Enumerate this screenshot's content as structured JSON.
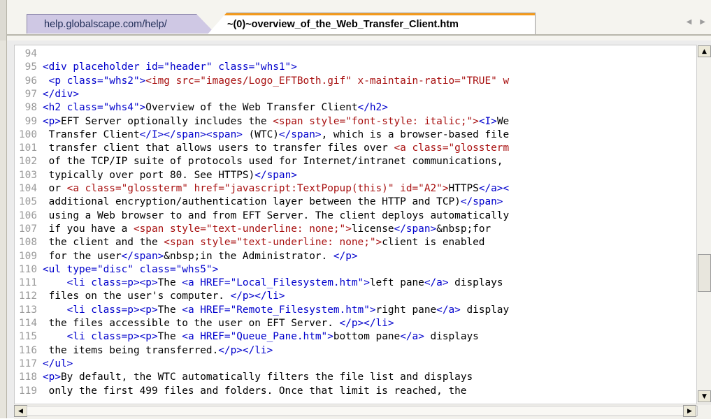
{
  "tabs": [
    {
      "label": "help.globalscape.com/help/"
    },
    {
      "label": "~(0)~overview_of_the_Web_Transfer_Client.htm"
    }
  ],
  "nav": {
    "left": "◀",
    "right": "▶"
  },
  "scroll": {
    "up": "▲",
    "down": "▼",
    "left": "◀",
    "right": "▶"
  },
  "code_lines": [
    {
      "n": "94",
      "segs": []
    },
    {
      "n": "95",
      "segs": [
        {
          "t": "t",
          "v": "<div placeholder id=\"header\" class=\"whs1\">"
        }
      ]
    },
    {
      "n": "96",
      "segs": [
        {
          "t": "t",
          "v": " <p class=\"whs2\">"
        },
        {
          "t": "s",
          "v": "<img src=\"images/Logo_EFTBoth.gif\" x-maintain-ratio=\"TRUE\" w"
        }
      ]
    },
    {
      "n": "97",
      "segs": [
        {
          "t": "t",
          "v": "</div>"
        }
      ]
    },
    {
      "n": "98",
      "segs": [
        {
          "t": "t",
          "v": "<h2 class=\"whs4\">"
        },
        {
          "t": "x",
          "v": "Overview of the Web Transfer Client"
        },
        {
          "t": "t",
          "v": "</h2>"
        }
      ]
    },
    {
      "n": "99",
      "segs": [
        {
          "t": "t",
          "v": "<p>"
        },
        {
          "t": "x",
          "v": "EFT Server optionally includes the "
        },
        {
          "t": "s",
          "v": "<span style=\"font-style: italic;\">"
        },
        {
          "t": "t",
          "v": "<I>"
        },
        {
          "t": "x",
          "v": "We"
        }
      ]
    },
    {
      "n": "100",
      "segs": [
        {
          "t": "x",
          "v": " Transfer Client"
        },
        {
          "t": "t",
          "v": "</I></span><span>"
        },
        {
          "t": "x",
          "v": " (WTC)"
        },
        {
          "t": "t",
          "v": "</span>"
        },
        {
          "t": "x",
          "v": ", which is a browser-based file"
        }
      ]
    },
    {
      "n": "101",
      "segs": [
        {
          "t": "x",
          "v": " transfer client that allows users to transfer files over "
        },
        {
          "t": "s",
          "v": "<a class=\"glossterm"
        }
      ]
    },
    {
      "n": "102",
      "segs": [
        {
          "t": "x",
          "v": " of the TCP/IP suite of protocols used for Internet/intranet communications,"
        }
      ]
    },
    {
      "n": "103",
      "segs": [
        {
          "t": "x",
          "v": " typically over port 80. See HTTPS)"
        },
        {
          "t": "t",
          "v": "</span>"
        }
      ]
    },
    {
      "n": "104",
      "segs": [
        {
          "t": "x",
          "v": " or "
        },
        {
          "t": "s",
          "v": "<a class=\"glossterm\" href=\"javascript:TextPopup(this)\" id=\"A2\">"
        },
        {
          "t": "x",
          "v": "HTTPS"
        },
        {
          "t": "t",
          "v": "</a><"
        }
      ]
    },
    {
      "n": "105",
      "segs": [
        {
          "t": "x",
          "v": " additional encryption/authentication layer between the HTTP and TCP)"
        },
        {
          "t": "t",
          "v": "</span>"
        }
      ]
    },
    {
      "n": "106",
      "segs": [
        {
          "t": "x",
          "v": " using a Web browser to and from EFT Server. The client deploys automatically"
        }
      ]
    },
    {
      "n": "107",
      "segs": [
        {
          "t": "x",
          "v": " if you have a "
        },
        {
          "t": "s",
          "v": "<span style=\"text-underline: none;\">"
        },
        {
          "t": "x",
          "v": "license"
        },
        {
          "t": "t",
          "v": "</span>"
        },
        {
          "t": "x",
          "v": "&nbsp;for"
        }
      ]
    },
    {
      "n": "108",
      "segs": [
        {
          "t": "x",
          "v": " the client and the "
        },
        {
          "t": "s",
          "v": "<span style=\"text-underline: none;\">"
        },
        {
          "t": "x",
          "v": "client is enabled"
        }
      ]
    },
    {
      "n": "109",
      "segs": [
        {
          "t": "x",
          "v": " for the user"
        },
        {
          "t": "t",
          "v": "</span>"
        },
        {
          "t": "x",
          "v": "&nbsp;in the Administrator. "
        },
        {
          "t": "t",
          "v": "</p>"
        }
      ]
    },
    {
      "n": "110",
      "segs": [
        {
          "t": "t",
          "v": "<ul type=\"disc\" class=\"whs5\">"
        }
      ]
    },
    {
      "n": "111",
      "segs": [
        {
          "t": "t",
          "v": "    <li class=p><p>"
        },
        {
          "t": "x",
          "v": "The "
        },
        {
          "t": "t",
          "v": "<a HREF=\"Local_Filesystem.htm\">"
        },
        {
          "t": "x",
          "v": "left pane"
        },
        {
          "t": "t",
          "v": "</a>"
        },
        {
          "t": "x",
          "v": " displays"
        }
      ]
    },
    {
      "n": "112",
      "segs": [
        {
          "t": "x",
          "v": " files on the user's computer. "
        },
        {
          "t": "t",
          "v": "</p></li>"
        }
      ]
    },
    {
      "n": "113",
      "segs": [
        {
          "t": "t",
          "v": "    <li class=p><p>"
        },
        {
          "t": "x",
          "v": "The "
        },
        {
          "t": "t",
          "v": "<a HREF=\"Remote_Filesystem.htm\">"
        },
        {
          "t": "x",
          "v": "right pane"
        },
        {
          "t": "t",
          "v": "</a>"
        },
        {
          "t": "x",
          "v": " display"
        }
      ]
    },
    {
      "n": "114",
      "segs": [
        {
          "t": "x",
          "v": " the files accessible to the user on EFT Server. "
        },
        {
          "t": "t",
          "v": "</p></li>"
        }
      ]
    },
    {
      "n": "115",
      "segs": [
        {
          "t": "t",
          "v": "    <li class=p><p>"
        },
        {
          "t": "x",
          "v": "The "
        },
        {
          "t": "t",
          "v": "<a HREF=\"Queue_Pane.htm\">"
        },
        {
          "t": "x",
          "v": "bottom pane"
        },
        {
          "t": "t",
          "v": "</a>"
        },
        {
          "t": "x",
          "v": " displays"
        }
      ]
    },
    {
      "n": "116",
      "segs": [
        {
          "t": "x",
          "v": " the items being transferred."
        },
        {
          "t": "t",
          "v": "</p></li>"
        }
      ]
    },
    {
      "n": "117",
      "segs": [
        {
          "t": "t",
          "v": "</ul>"
        }
      ]
    },
    {
      "n": "118",
      "segs": [
        {
          "t": "t",
          "v": "<p>"
        },
        {
          "t": "x",
          "v": "By default, the WTC automatically filters the file list and displays"
        }
      ]
    },
    {
      "n": "119",
      "segs": [
        {
          "t": "x",
          "v": " only the first 499 files and folders. Once that limit is reached, the"
        }
      ]
    }
  ]
}
